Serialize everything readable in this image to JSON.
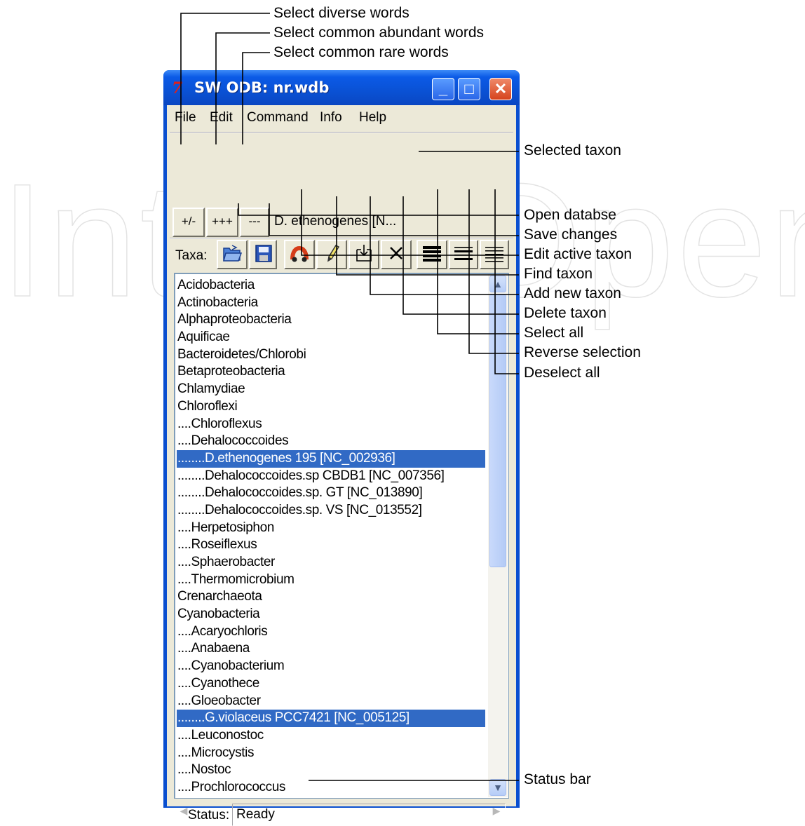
{
  "window": {
    "title": "SW ODB: nr.wdb",
    "minimize_glyph": "_",
    "maximize_glyph": "□",
    "close_glyph": "✕"
  },
  "menu": [
    "File",
    "Edit",
    "Command",
    "Info",
    "Help"
  ],
  "word_toolbar": {
    "diverse_label": "+/-",
    "abundant_label": "+++",
    "rare_label": "---",
    "selected_taxon": "D. ethenogenes [N..."
  },
  "taxa_toolbar": {
    "label": "Taxa:",
    "icons": [
      "open-folder-icon",
      "save-disk-icon",
      "binoculars-icon",
      "pencil-icon",
      "add-box-icon",
      "delete-x-icon",
      "select-all-lines-icon",
      "reverse-selection-lines-icon",
      "deselect-all-lines-icon"
    ]
  },
  "taxa_list": [
    "Acidobacteria",
    "Actinobacteria",
    "Alphaproteobacteria",
    "Aquificae",
    "Bacteroidetes/Chlorobi",
    "Betaproteobacteria",
    "Chlamydiae",
    "Chloroflexi",
    "....Chloroflexus",
    "....Dehalococcoides",
    "........D.ethenogenes 195 [NC_002936]",
    "........Dehalococcoides.sp CBDB1 [NC_007356]",
    "........Dehalococcoides.sp. GT [NC_013890]",
    "........Dehalococcoides.sp. VS [NC_013552]",
    "....Herpetosiphon",
    "....Roseiflexus",
    "....Sphaerobacter",
    "....Thermomicrobium",
    "Crenarchaeota",
    "Cyanobacteria",
    "....Acaryochloris",
    "....Anabaena",
    "....Cyanobacterium",
    "....Cyanothece",
    "....Gloeobacter",
    "........G.violaceus PCC7421 [NC_005125]",
    "....Leuconostoc",
    "....Microcystis",
    "....Nostoc",
    "....Prochlorococcus"
  ],
  "selected_rows": [
    10,
    25
  ],
  "status": {
    "label": "Status:",
    "value": "Ready"
  },
  "callouts": {
    "select_diverse": "Select diverse words",
    "select_abundant": "Select common abundant words",
    "select_rare": "Select common rare words",
    "selected_taxon": "Selected taxon",
    "open_database": "Open databse",
    "save_changes": "Save changes",
    "edit_active": "Edit active taxon",
    "find_taxon": "Find taxon",
    "add_taxon": "Add new taxon",
    "delete_taxon": "Delete taxon",
    "select_all": "Select all",
    "reverse_selection": "Reverse selection",
    "deselect_all": "Deselect all",
    "status_bar": "Status bar"
  },
  "colors": {
    "title_bar": "#0a4fd0",
    "selection": "#316ac5",
    "window_face": "#ece9d8"
  }
}
